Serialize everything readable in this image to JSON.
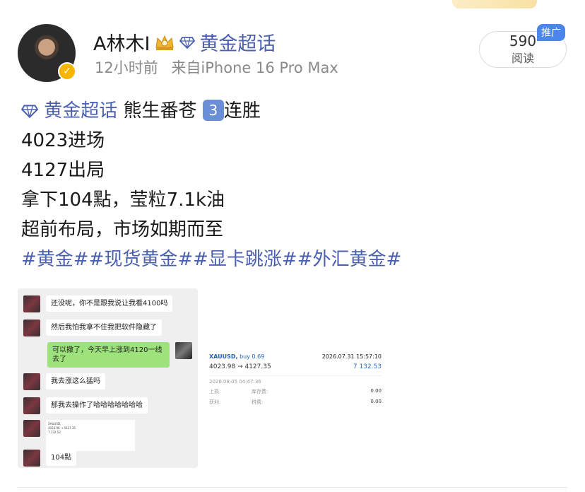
{
  "user": {
    "name": "A林木I",
    "topic": "黄金超话"
  },
  "meta": {
    "time": "12小时前",
    "source": "来自iPhone 16 Pro Max"
  },
  "stats": {
    "read_count": "590",
    "read_label": "阅读",
    "promo": "推广"
  },
  "post": {
    "topic_tag": "黄金超话",
    "line1_text": "熊生番苍",
    "line1_num": "3",
    "line1_suffix": "连胜",
    "line2": "4023进场",
    "line3": "4127出局",
    "line4": "拿下104點，莹粒7.1k油",
    "line5": "超前布局，市场如期而至",
    "hashtags": "#黄金##现货黄金##显卡跳涨##外汇黄金#"
  },
  "chat": {
    "messages": [
      "还没呢，你不是跟我说让我看4100吗",
      "然后我怕我拿不住我把软件隐藏了",
      "可以撤了，今天早上涨到4120一线去了",
      "我去涨这么猛吗",
      "那我去操作了哈哈哈哈哈哈哈",
      "104點"
    ]
  },
  "trade": {
    "symbol": "XAUUSD,",
    "side": "buy 0.69",
    "close_time": "2026.07.31 15:57:10",
    "prices": "4023.98 → 4127.35",
    "profit": "7 132.53",
    "open_time": "2026.08.05 04:47:36",
    "row1_label": "上损:",
    "row1_mid": "库存费:",
    "row1_val": "0.00",
    "row2_label": "获利:",
    "row2_mid": "税费:",
    "row2_val": "0.00"
  },
  "colors": {
    "link": "#4a5fb0",
    "badge": "#4b86ea",
    "chat_green": "#9de27b"
  }
}
